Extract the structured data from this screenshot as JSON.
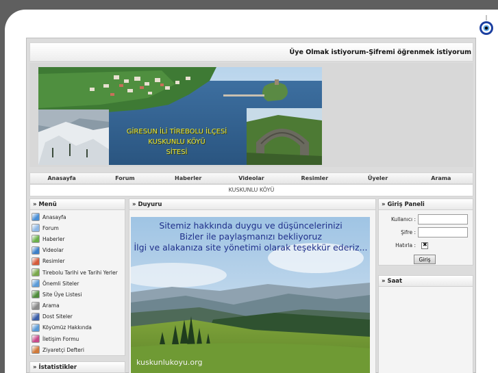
{
  "topbar": {
    "register_link": "Üye Olmak istiyorum",
    "separator": " - ",
    "password_link": "Şifremi öğrenmek istiyorum"
  },
  "banner": {
    "text_line1": "GİRESUN İLİ TİREBOLU İLÇESİ",
    "text_line2": "KUSKUNLU KÖYÜ",
    "text_line3": "SİTESİ"
  },
  "nav": {
    "items": [
      {
        "label": "Anasayfa"
      },
      {
        "label": "Forum"
      },
      {
        "label": "Haberler"
      },
      {
        "label": "Videolar"
      },
      {
        "label": "Resimler"
      },
      {
        "label": "Üyeler"
      },
      {
        "label": "Arama"
      }
    ]
  },
  "subtitle": "KUSKUNLU KÖYÜ",
  "menu": {
    "title": "» Menü",
    "items": [
      {
        "label": "Anasayfa",
        "icon": "globe-icon",
        "color": "#4a8fd6"
      },
      {
        "label": "Forum",
        "icon": "document-icon",
        "color": "#8fb8e6"
      },
      {
        "label": "Haberler",
        "icon": "news-icon",
        "color": "#6bb04a"
      },
      {
        "label": "Videolar",
        "icon": "video-icon",
        "color": "#3c7fc8"
      },
      {
        "label": "Resimler",
        "icon": "picture-icon",
        "color": "#d65a3a"
      },
      {
        "label": "Tirebolu Tarihi ve Tarihi Yerler",
        "icon": "history-icon",
        "color": "#7aa84c"
      },
      {
        "label": "Önemli Siteler",
        "icon": "sites-icon",
        "color": "#5b9bd8"
      },
      {
        "label": "Site Üye Listesi",
        "icon": "members-icon",
        "color": "#4f8c3c"
      },
      {
        "label": "Arama",
        "icon": "search-icon",
        "color": "#8a8a8a"
      },
      {
        "label": "Dost Siteler",
        "icon": "friends-icon",
        "color": "#3b5ea8"
      },
      {
        "label": "Köyümüz Hakkında",
        "icon": "village-icon",
        "color": "#5a9ad6"
      },
      {
        "label": "İletişim Formu",
        "icon": "contact-icon",
        "color": "#c84a8a"
      },
      {
        "label": "Ziyaretçi Defteri",
        "icon": "guestbook-icon",
        "color": "#d07a3a"
      }
    ]
  },
  "stats": {
    "title": "» İstatistikler"
  },
  "announcement": {
    "title": "» Duyuru",
    "line1": "Sitemiz hakkında duygu ve düşüncelerinizi",
    "line2": "Bizler ile paylaşmanızı bekliyoruz",
    "line3": "İlgi ve alakanıza site yönetimi olarak teşekkür ederiz...",
    "watermark": "kuskunlukoyu.org"
  },
  "login": {
    "title": "» Giriş Paneli",
    "username_label": "Kullanıcı :",
    "password_label": "Şifre :",
    "remember_label": "Hatırla :",
    "button_label": "Giriş"
  },
  "clock": {
    "title": "» Saat"
  }
}
